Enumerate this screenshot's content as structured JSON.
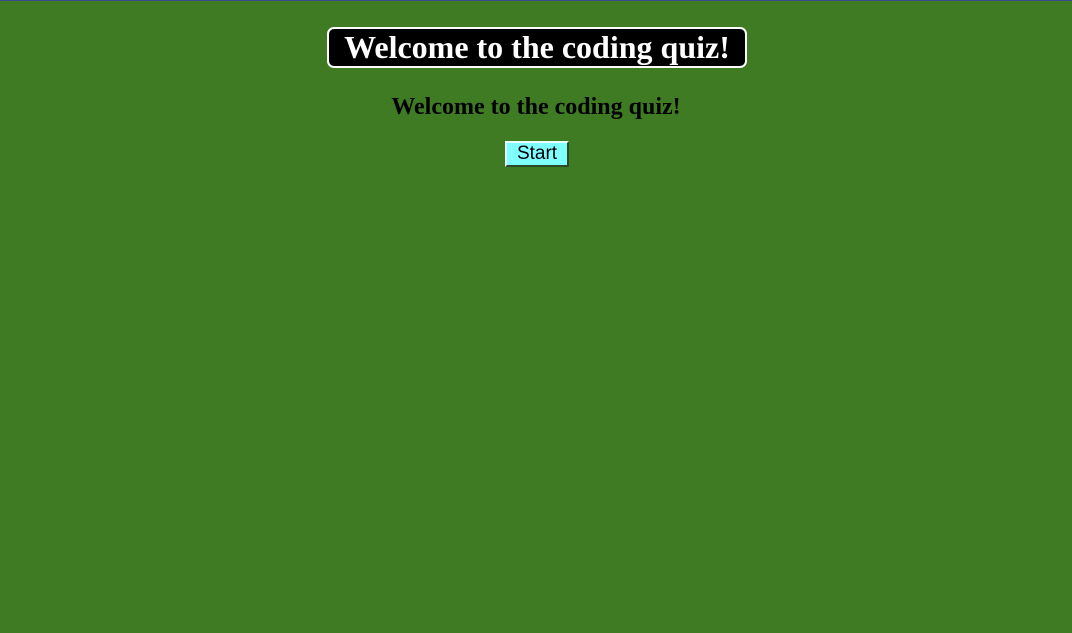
{
  "header": {
    "title": "Welcome to the coding quiz!"
  },
  "main": {
    "subtitle": "Welcome to the coding quiz!",
    "start_label": "Start"
  },
  "colors": {
    "background": "#3e7b23",
    "title_background": "#000000",
    "title_text": "#ffffff",
    "button_background": "#80ffff"
  }
}
